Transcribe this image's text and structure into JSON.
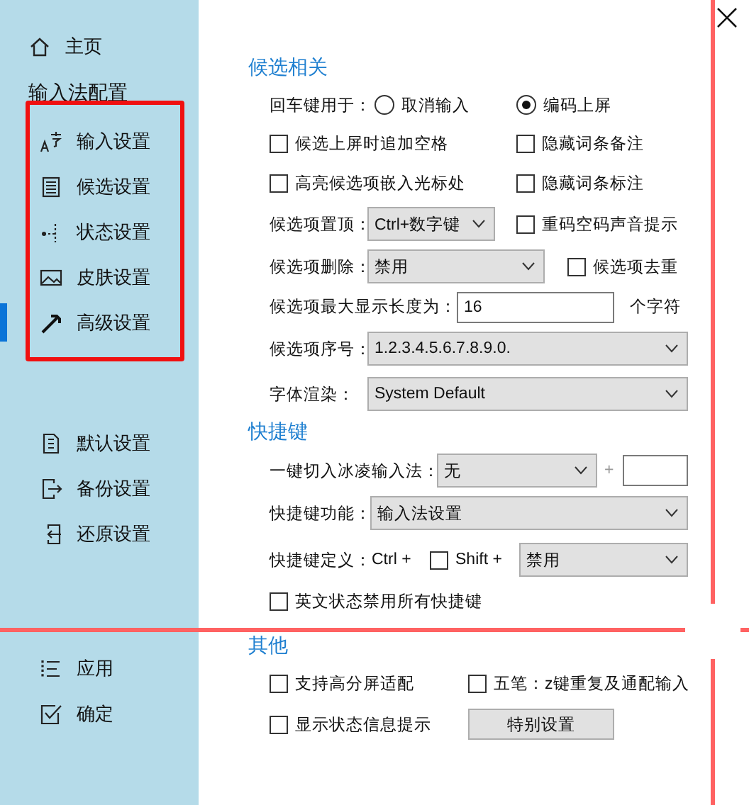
{
  "sidebar": {
    "home": {
      "label": "主页"
    },
    "group_title": "输入法配置",
    "items": [
      {
        "label": "输入设置",
        "kind": "input",
        "selected": false
      },
      {
        "label": "候选设置",
        "kind": "list",
        "selected": false
      },
      {
        "label": "状态设置",
        "kind": "status",
        "selected": false
      },
      {
        "label": "皮肤设置",
        "kind": "image",
        "selected": false
      },
      {
        "label": "高级设置",
        "kind": "tool",
        "selected": true
      }
    ],
    "actions": [
      {
        "label": "默认设置",
        "kind": "default"
      },
      {
        "label": "备份设置",
        "kind": "backup"
      },
      {
        "label": "还原设置",
        "kind": "restore"
      }
    ],
    "bottom": [
      {
        "label": "应用",
        "kind": "apply"
      },
      {
        "label": "确定",
        "kind": "ok"
      }
    ]
  },
  "sections": [
    {
      "title": "候选相关",
      "rows": [
        [
          {
            "kind": "label",
            "text": "回车键用于："
          },
          {
            "kind": "radio",
            "label": "取消输入",
            "selected": false
          },
          {
            "kind": "radio",
            "label": "编码上屏",
            "selected": true
          }
        ],
        [
          {
            "kind": "checkbox",
            "label": "候选上屏时追加空格",
            "checked": false
          },
          {
            "kind": "checkbox",
            "label": "隐藏词条备注",
            "checked": false
          }
        ],
        [
          {
            "kind": "checkbox",
            "label": "高亮候选项嵌入光标处",
            "checked": false
          },
          {
            "kind": "checkbox",
            "label": "隐藏词条标注",
            "checked": false
          }
        ],
        [
          {
            "kind": "label",
            "text": "候选项置顶："
          },
          {
            "kind": "select",
            "value": "Ctrl+数字键"
          },
          {
            "kind": "checkbox",
            "label": "重码空码声音提示",
            "checked": false
          }
        ],
        [
          {
            "kind": "label",
            "text": "候选项删除："
          },
          {
            "kind": "select",
            "value": "禁用"
          },
          {
            "kind": "checkbox",
            "label": "候选项去重",
            "checked": false
          }
        ],
        [
          {
            "kind": "label",
            "text": "候选项最大显示长度为："
          },
          {
            "kind": "input",
            "value": "16"
          },
          {
            "kind": "label",
            "text": "个字符"
          }
        ],
        [
          {
            "kind": "label",
            "text": "候选项序号："
          },
          {
            "kind": "select",
            "value": "1.2.3.4.5.6.7.8.9.0."
          }
        ],
        [
          {
            "kind": "label",
            "text": "字体渲染："
          },
          {
            "kind": "select",
            "value": "System Default"
          }
        ]
      ]
    },
    {
      "title": "快捷键",
      "rows": [
        [
          {
            "kind": "label",
            "text": "一键切入冰凌输入法："
          },
          {
            "kind": "select",
            "value": "无"
          },
          {
            "kind": "plus",
            "text": "+"
          },
          {
            "kind": "input"
          }
        ],
        [
          {
            "kind": "label",
            "text": "快捷键功能："
          },
          {
            "kind": "select",
            "value": "输入法设置"
          }
        ],
        [
          {
            "kind": "label",
            "text": "快捷键定义："
          },
          {
            "kind": "label",
            "text": "Ctrl +"
          },
          {
            "kind": "checkbox",
            "label": "Shift +",
            "checked": false
          },
          {
            "kind": "select",
            "value": "禁用"
          }
        ],
        [
          {
            "kind": "checkbox",
            "label": "英文状态禁用所有快捷键",
            "checked": false
          }
        ]
      ]
    },
    {
      "title": "其他",
      "rows": [
        [
          {
            "kind": "checkbox",
            "label": "支持高分屏适配",
            "checked": false
          },
          {
            "kind": "checkbox",
            "label": "五笔：z键重复及通配输入",
            "checked": false
          }
        ],
        [
          {
            "kind": "checkbox",
            "label": "显示状态信息提示",
            "checked": false
          },
          {
            "kind": "button",
            "label": "特别设置"
          }
        ]
      ]
    }
  ]
}
